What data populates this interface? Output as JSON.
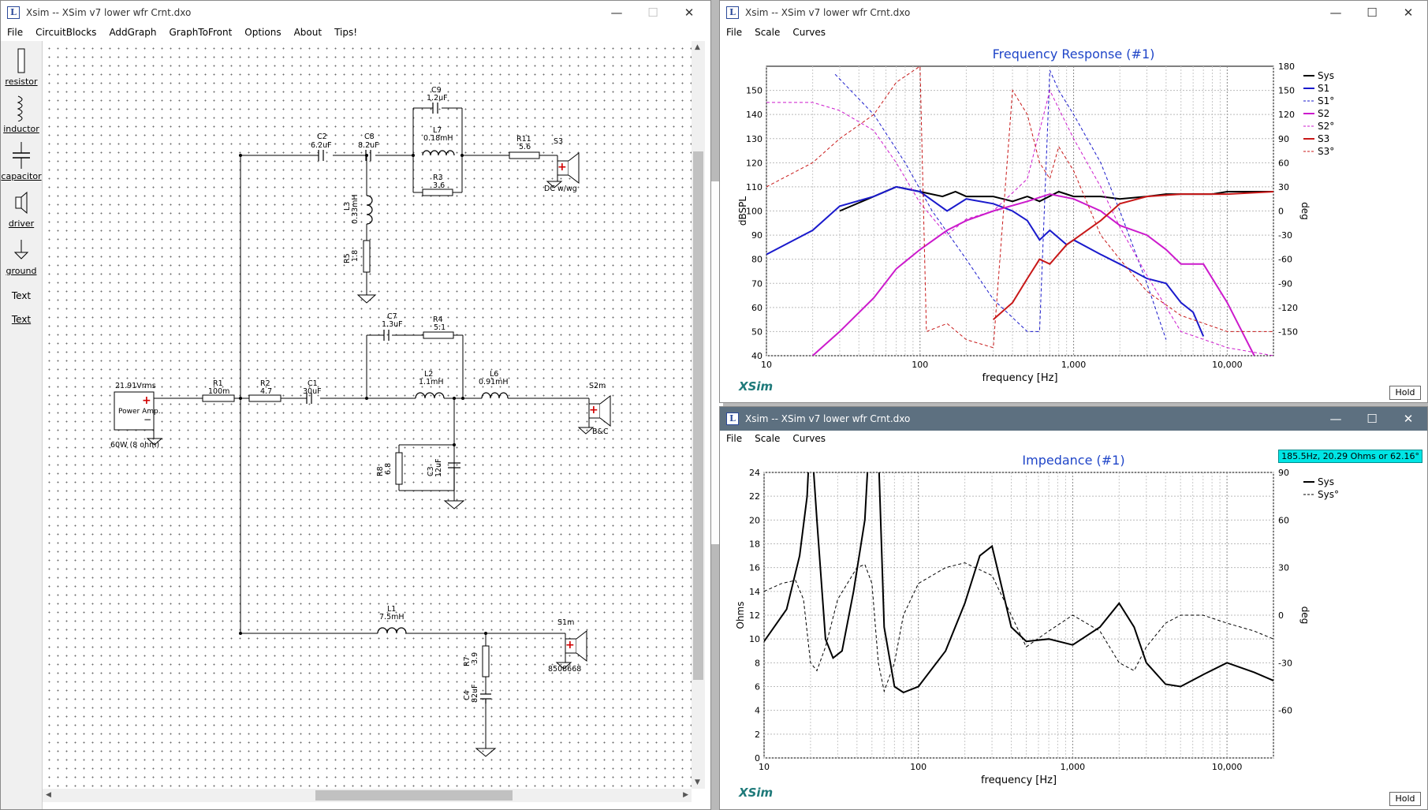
{
  "colors": {
    "sys": "#000000",
    "s1": "#1a1acc",
    "s2": "#cc1acc",
    "s3": "#c81818",
    "accent": "#1f45c8",
    "tooltip": "#00e5e5"
  },
  "schematic_window": {
    "title": "Xsim -- XSim v7 lower wfr Crnt.dxo",
    "menu": [
      "File",
      "CircuitBlocks",
      "AddGraph",
      "GraphToFront",
      "Options",
      "About",
      "Tips!"
    ],
    "palette": [
      {
        "label": "resistor",
        "icon": "resistor-icon"
      },
      {
        "label": "inductor",
        "icon": "inductor-icon"
      },
      {
        "label": "capacitor",
        "icon": "capacitor-icon"
      },
      {
        "label": "driver",
        "icon": "driver-icon"
      },
      {
        "label": "ground",
        "icon": "ground-icon"
      },
      {
        "label": "Text",
        "icon": "text-box-icon"
      },
      {
        "label": "Text",
        "icon": "text-icon"
      }
    ],
    "components": {
      "amp": {
        "name": "Power Amp.",
        "value": "21.91Vrms",
        "note": "60W (8 ohm)"
      },
      "R1": {
        "name": "R1",
        "value": "100m"
      },
      "R2": {
        "name": "R2",
        "value": "4.7"
      },
      "C1": {
        "name": "C1",
        "value": "30uF"
      },
      "C2": {
        "name": "C2",
        "value": "6.2uF"
      },
      "C8": {
        "name": "C8",
        "value": "8.2uF"
      },
      "C9": {
        "name": "C9",
        "value": "1.2uF"
      },
      "L7": {
        "name": "L7",
        "value": "0.18mH"
      },
      "R3": {
        "name": "R3",
        "value": "3.6"
      },
      "R11": {
        "name": "R11",
        "value": "5.6"
      },
      "S3": {
        "name": "S3",
        "value": "DC w/wg"
      },
      "L3": {
        "name": "L3",
        "value": "0.33mH"
      },
      "R5": {
        "name": "R5",
        "value": "1.8"
      },
      "C7": {
        "name": "C7",
        "value": "1.3uF"
      },
      "R4": {
        "name": "R4",
        "value": "5.1"
      },
      "L2": {
        "name": "L2",
        "value": "1.1mH"
      },
      "L6": {
        "name": "L6",
        "value": "0.91mH"
      },
      "S2m": {
        "name": "S2m",
        "value": "B&C"
      },
      "R8": {
        "name": "R8",
        "value": "6.8"
      },
      "C3": {
        "name": "C3",
        "value": "12uF"
      },
      "L1": {
        "name": "L1",
        "value": "7.5mH"
      },
      "S1m": {
        "name": "S1m",
        "value": "8508668"
      },
      "R7": {
        "name": "R7",
        "value": "3.9"
      },
      "C4": {
        "name": "C4",
        "value": "82uF"
      }
    }
  },
  "fr_window": {
    "title": "Xsim -- XSim v7 lower wfr Crnt.dxo",
    "menu": [
      "File",
      "Scale",
      "Curves"
    ],
    "hold": "Hold",
    "brand": "XSim"
  },
  "imp_window": {
    "title": "Xsim -- XSim v7 lower wfr Crnt.dxo",
    "menu": [
      "File",
      "Scale",
      "Curves"
    ],
    "hold": "Hold",
    "brand": "XSim",
    "cursor_readout": "185.5Hz, 20.29 Ohms or 62.16°"
  },
  "chart_data": [
    {
      "type": "line",
      "title": "Frequency Response (#1)",
      "xlabel": "frequency [Hz]",
      "ylabel": "dBSPL",
      "y2label": "deg",
      "xscale": "log",
      "xlim": [
        10,
        20000
      ],
      "ylim": [
        40,
        160
      ],
      "y2lim": [
        -180,
        180
      ],
      "xticklabels": [
        "10",
        "100",
        "1,000",
        "10,000"
      ],
      "yticks": [
        40,
        50,
        60,
        70,
        80,
        90,
        100,
        110,
        120,
        130,
        140,
        150
      ],
      "y2ticks": [
        -150,
        -120,
        -90,
        -60,
        -30,
        0,
        30,
        60,
        90,
        120,
        150,
        180
      ],
      "legend_position": "right",
      "grid": true,
      "series": [
        {
          "name": "Sys",
          "color": "#000000",
          "style": "solid",
          "x": [
            30,
            50,
            70,
            100,
            140,
            170,
            200,
            300,
            400,
            500,
            600,
            800,
            1000,
            1500,
            2000,
            3000,
            4000,
            6000,
            8000,
            10000,
            15000,
            20000
          ],
          "y": [
            100,
            106,
            110,
            108,
            106,
            108,
            106,
            106,
            104,
            106,
            104,
            108,
            106,
            106,
            105,
            106,
            107,
            107,
            107,
            108,
            108,
            108
          ]
        },
        {
          "name": "S1",
          "color": "#1a1acc",
          "style": "solid",
          "x": [
            10,
            20,
            30,
            50,
            70,
            100,
            150,
            200,
            300,
            400,
            500,
            600,
            700,
            900,
            1000,
            1500,
            2000,
            3000,
            4000,
            5000,
            6000,
            7000
          ],
          "y": [
            82,
            92,
            102,
            106,
            110,
            108,
            100,
            105,
            103,
            100,
            96,
            88,
            92,
            86,
            88,
            82,
            78,
            72,
            70,
            62,
            58,
            48
          ]
        },
        {
          "name": "S1°",
          "color": "#1a1acc",
          "style": "dashed",
          "x": [
            28,
            50,
            80,
            120,
            200,
            300,
            500,
            600,
            700,
            800,
            1000,
            1500,
            2000,
            3000,
            4000
          ],
          "y": [
            170,
            120,
            60,
            0,
            -60,
            -110,
            -150,
            -150,
            175,
            150,
            120,
            60,
            0,
            -90,
            -160
          ]
        },
        {
          "name": "S2",
          "color": "#cc1acc",
          "style": "solid",
          "x": [
            20,
            30,
            50,
            70,
            100,
            150,
            200,
            300,
            500,
            700,
            1000,
            1500,
            2000,
            3000,
            4000,
            5000,
            7000,
            10000,
            15000
          ],
          "y": [
            40,
            50,
            64,
            76,
            84,
            92,
            96,
            100,
            104,
            107,
            105,
            100,
            94,
            90,
            84,
            78,
            78,
            62,
            40
          ]
        },
        {
          "name": "S2°",
          "color": "#cc1acc",
          "style": "dashed",
          "x": [
            10,
            20,
            30,
            50,
            70,
            100,
            150,
            200,
            300,
            500,
            700,
            1000,
            1500,
            2000,
            3000,
            5000,
            10000,
            20000
          ],
          "y": [
            135,
            135,
            125,
            100,
            60,
            10,
            -30,
            -10,
            0,
            40,
            150,
            90,
            30,
            -20,
            -80,
            -150,
            -170,
            -180
          ]
        },
        {
          "name": "S3",
          "color": "#c81818",
          "style": "solid",
          "x": [
            300,
            400,
            500,
            600,
            700,
            900,
            1000,
            1500,
            2000,
            3000,
            5000,
            10000,
            20000
          ],
          "y": [
            55,
            62,
            72,
            80,
            78,
            86,
            88,
            96,
            103,
            106,
            107,
            107,
            108
          ]
        },
        {
          "name": "S3°",
          "color": "#c81818",
          "style": "dashed",
          "x": [
            10,
            20,
            30,
            50,
            70,
            100,
            110,
            150,
            200,
            300,
            400,
            500,
            600,
            700,
            800,
            1000,
            1500,
            2000,
            3000,
            5000,
            10000,
            20000
          ],
          "y": [
            30,
            60,
            90,
            120,
            160,
            180,
            -150,
            -140,
            -160,
            -170,
            150,
            120,
            60,
            40,
            80,
            50,
            -30,
            -60,
            -100,
            -130,
            -150,
            -150
          ]
        }
      ]
    },
    {
      "type": "line",
      "title": "Impedance (#1)",
      "xlabel": "frequency [Hz]",
      "ylabel": "Ohms",
      "y2label": "deg",
      "xscale": "log",
      "xlim": [
        10,
        20000
      ],
      "ylim": [
        0,
        24
      ],
      "y2lim": [
        -90,
        90
      ],
      "xticklabels": [
        "10",
        "100",
        "1,000",
        "10,000"
      ],
      "yticks": [
        0,
        2,
        4,
        6,
        8,
        10,
        12,
        14,
        16,
        18,
        20,
        22,
        24
      ],
      "y2ticks": [
        -60,
        -30,
        0,
        30,
        60,
        90
      ],
      "legend_position": "top-right",
      "grid": true,
      "series": [
        {
          "name": "Sys",
          "color": "#000000",
          "style": "solid",
          "x": [
            10,
            14,
            17,
            19,
            20,
            22,
            25,
            28,
            32,
            38,
            45,
            52,
            55,
            60,
            70,
            80,
            100,
            150,
            200,
            250,
            300,
            400,
            500,
            700,
            1000,
            1500,
            2000,
            2500,
            3000,
            4000,
            5000,
            7000,
            10000,
            15000,
            20000
          ],
          "y": [
            9.8,
            12.5,
            17,
            22,
            28,
            20,
            10,
            8.4,
            9,
            14,
            20,
            35,
            26,
            11,
            6,
            5.5,
            6,
            9,
            13,
            17,
            17.8,
            11,
            9.8,
            10,
            9.5,
            11,
            13,
            11,
            8,
            6.2,
            6,
            7,
            8,
            7.2,
            6.5
          ]
        },
        {
          "name": "Sys°",
          "color": "#000000",
          "style": "dashed",
          "x": [
            10,
            13,
            16,
            18,
            20,
            22,
            25,
            30,
            40,
            45,
            50,
            55,
            60,
            70,
            80,
            100,
            150,
            200,
            300,
            400,
            500,
            700,
            1000,
            1500,
            2000,
            2500,
            3000,
            4000,
            5000,
            7000,
            10000,
            15000,
            20000
          ],
          "y": [
            15,
            20,
            22,
            10,
            -30,
            -35,
            -20,
            10,
            30,
            32,
            20,
            -30,
            -48,
            -30,
            0,
            20,
            30,
            33,
            25,
            0,
            -20,
            -10,
            0,
            -10,
            -30,
            -35,
            -20,
            -5,
            0,
            0,
            -5,
            -10,
            -15
          ]
        }
      ]
    }
  ]
}
